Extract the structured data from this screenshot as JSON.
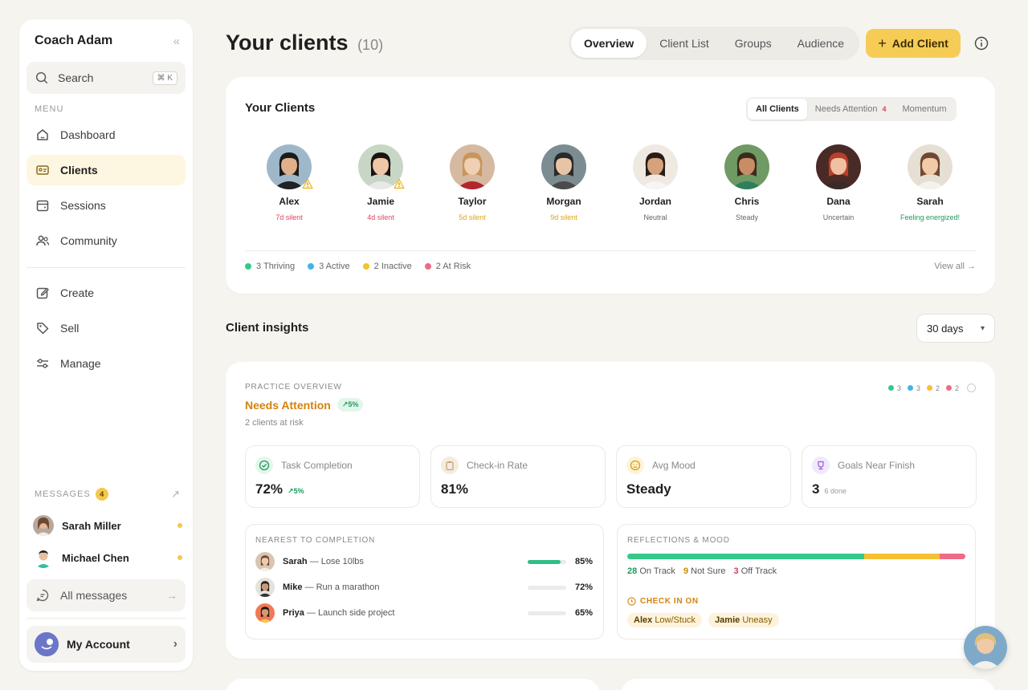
{
  "sidebar": {
    "title": "Coach Adam",
    "search_label": "Search",
    "search_shortcut": "⌘ K",
    "menu_label": "MENU",
    "nav": [
      {
        "label": "Dashboard",
        "icon": "home-icon"
      },
      {
        "label": "Clients",
        "icon": "id-card-icon",
        "active": true
      },
      {
        "label": "Sessions",
        "icon": "calendar-icon"
      },
      {
        "label": "Community",
        "icon": "people-icon"
      },
      {
        "label": "Create",
        "icon": "edit-icon"
      },
      {
        "label": "Sell",
        "icon": "tag-icon"
      },
      {
        "label": "Manage",
        "icon": "sliders-icon"
      }
    ],
    "messages_label": "MESSAGES",
    "messages_count": "4",
    "messages": [
      {
        "name": "Sarah Miller"
      },
      {
        "name": "Michael Chen"
      }
    ],
    "all_messages": "All messages",
    "account": "My Account"
  },
  "header": {
    "title": "Your clients",
    "count": "(10)",
    "tabs": [
      "Overview",
      "Client List",
      "Groups",
      "Audience"
    ],
    "active_tab": "Overview",
    "add_button": "Add Client"
  },
  "clients_card": {
    "title": "Your Clients",
    "filters": [
      {
        "label": "All Clients"
      },
      {
        "label": "Needs Attention",
        "badge": "4"
      },
      {
        "label": "Momentum"
      }
    ],
    "clients": [
      {
        "name": "Alex",
        "status": "7d silent",
        "status_color": "#e0435e",
        "warning": true
      },
      {
        "name": "Jamie",
        "status": "4d silent",
        "status_color": "#e0435e",
        "warning": true
      },
      {
        "name": "Taylor",
        "status": "5d silent",
        "status_color": "#e0a413",
        "warning": false
      },
      {
        "name": "Morgan",
        "status": "9d silent",
        "status_color": "#e0a413",
        "warning": false
      },
      {
        "name": "Jordan",
        "status": "Neutral",
        "status_color": "#666666",
        "warning": false
      },
      {
        "name": "Chris",
        "status": "Steady",
        "status_color": "#666666",
        "warning": false
      },
      {
        "name": "Dana",
        "status": "Uncertain",
        "status_color": "#666666",
        "warning": false
      },
      {
        "name": "Sarah",
        "status": "Feeling energized!",
        "status_color": "#1f9a5b",
        "warning": false
      }
    ],
    "legend": [
      {
        "label": "3 Thriving",
        "color": "#34c98a"
      },
      {
        "label": "3 Active",
        "color": "#3fb5ec"
      },
      {
        "label": "2 Inactive",
        "color": "#f5c032"
      },
      {
        "label": "2 At Risk",
        "color": "#ee6b85"
      }
    ],
    "view_all": "View all →"
  },
  "insights": {
    "title": "Client insights",
    "range": "30 days",
    "overview_label": "PRACTICE OVERVIEW",
    "status": "Needs Attention",
    "status_trend": "↗5%",
    "subtitle": "2 clients at risk",
    "mini_legend": [
      {
        "value": "3",
        "color": "#34c98a"
      },
      {
        "value": "3",
        "color": "#3fb5ec"
      },
      {
        "value": "2",
        "color": "#f5c032"
      },
      {
        "value": "2",
        "color": "#ee6b85"
      }
    ],
    "metrics": [
      {
        "label": "Task Completion",
        "value": "72%",
        "trend": "↗5%",
        "sub": "",
        "icon": "check-circle-icon",
        "icon_bg": "#e3f6ec"
      },
      {
        "label": "Check-in Rate",
        "value": "81%",
        "trend": "",
        "sub": "",
        "icon": "clipboard-icon",
        "icon_bg": "#f3ece0"
      },
      {
        "label": "Avg Mood",
        "value": "Steady",
        "trend": "",
        "sub": "",
        "icon": "smile-icon",
        "icon_bg": "#fdf3da"
      },
      {
        "label": "Goals Near Finish",
        "value": "3",
        "trend": "",
        "sub": "6 done",
        "icon": "trophy-icon",
        "icon_bg": "#f1e8fb"
      }
    ],
    "nearest_label": "NEAREST TO COMPLETION",
    "goals": [
      {
        "name": "Sarah",
        "goal": "— Lose 10lbs",
        "pct": "85%",
        "value": 0.85
      },
      {
        "name": "Mike",
        "goal": "— Run a marathon",
        "pct": "72%",
        "value": 0.72
      },
      {
        "name": "Priya",
        "goal": "— Launch side project",
        "pct": "65%",
        "value": 0.65
      }
    ],
    "reflections_label": "REFLECTIONS & MOOD",
    "mood": [
      {
        "count": "28",
        "label": "On Track",
        "value": 28,
        "color": "#34c98a"
      },
      {
        "count": "9",
        "label": "Not Sure",
        "value": 9,
        "color": "#f5c032"
      },
      {
        "count": "3",
        "label": "Off Track",
        "value": 3,
        "color": "#ee6b85"
      }
    ],
    "checkin_label": "CHECK IN ON",
    "checkins": [
      {
        "name": "Alex",
        "note": "Low/Stuck"
      },
      {
        "name": "Jamie",
        "note": "Uneasy"
      }
    ]
  }
}
